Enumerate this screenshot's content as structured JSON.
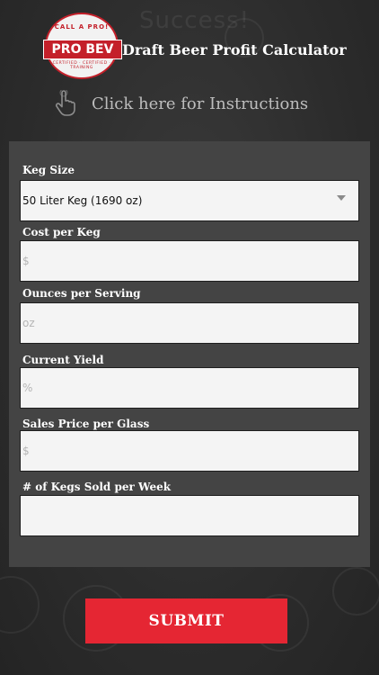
{
  "brand": {
    "logo_top_text": "CALL A PRO!",
    "logo_name": "PRO BEV",
    "logo_bottom_text": "CERTIFIED · CERTIFIED · TRAINING",
    "accent_color": "#e52633"
  },
  "header": {
    "title": "Draft Beer Profit Calculator",
    "instructions_label": "Click here for Instructions",
    "instructions_icon": "hand-pointer-icon"
  },
  "form": {
    "keg_size": {
      "label": "Keg Size",
      "value": "50 Liter Keg (1690 oz)"
    },
    "cost_per_keg": {
      "label": "Cost per Keg",
      "placeholder": "$"
    },
    "ounces_per_serving": {
      "label": "Ounces per Serving",
      "placeholder": "oz"
    },
    "current_yield": {
      "label": "Current Yield",
      "placeholder": "%"
    },
    "sales_price": {
      "label": "Sales Price per Glass",
      "placeholder": "$"
    },
    "kegs_sold": {
      "label": "# of Kegs Sold per Week",
      "placeholder": ""
    },
    "submit_label": "SUBMIT"
  }
}
